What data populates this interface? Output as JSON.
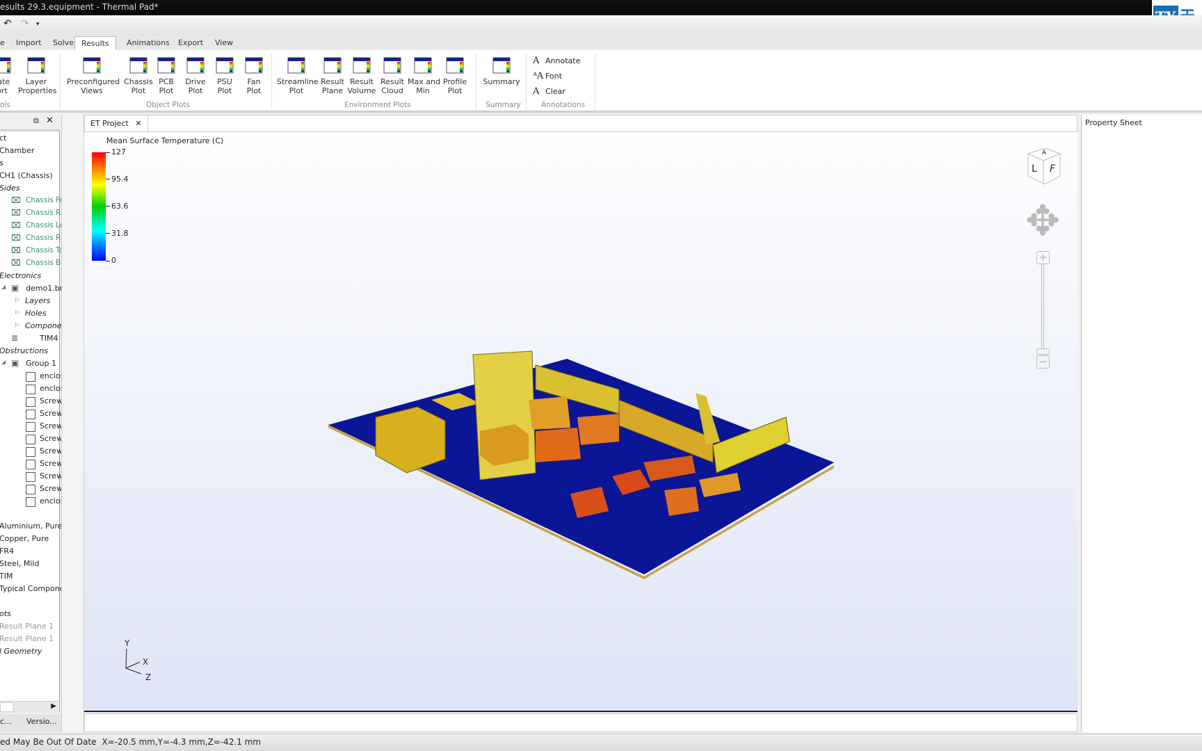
{
  "window": {
    "title": "esults 29.3.equipment - Thermal Pad*"
  },
  "logo": {
    "text": "TY 天 tian",
    "bg": "#1a6fb0"
  },
  "menu_tabs": [
    {
      "label": "e"
    },
    {
      "label": "Import"
    },
    {
      "label": "Solve"
    },
    {
      "label": "Results",
      "active": true
    },
    {
      "label": "Animations"
    },
    {
      "label": "Export"
    },
    {
      "label": "View"
    }
  ],
  "ribbon": {
    "tools": [
      {
        "label": "rate\nort",
        "icon": "report-icon"
      },
      {
        "label": "Layer\nProperties",
        "icon": "layer-properties-icon"
      }
    ],
    "tools_group": "ols",
    "object_plots": [
      {
        "label": "Preconfigured\nViews",
        "icon": "preconfigured-views-icon"
      },
      {
        "label": "Chassis\nPlot",
        "icon": "chassis-plot-icon"
      },
      {
        "label": "PCB\nPlot",
        "icon": "pcb-plot-icon"
      },
      {
        "label": "Drive\nPlot",
        "icon": "drive-plot-icon"
      },
      {
        "label": "PSU\nPlot",
        "icon": "psu-plot-icon"
      },
      {
        "label": "Fan\nPlot",
        "icon": "fan-plot-icon"
      }
    ],
    "object_plots_group": "Object Plots",
    "environment_plots": [
      {
        "label": "Streamline\nPlot",
        "icon": "streamline-icon"
      },
      {
        "label": "Result\nPlane",
        "icon": "result-plane-icon"
      },
      {
        "label": "Result\nVolume",
        "icon": "result-volume-icon"
      },
      {
        "label": "Result\nCloud",
        "icon": "result-cloud-icon"
      },
      {
        "label": "Max and\nMin",
        "icon": "max-min-icon"
      },
      {
        "label": "Profile\nPlot",
        "icon": "profile-plot-icon"
      }
    ],
    "environment_plots_group": "Environment Plots",
    "summary": {
      "label": "Summary",
      "group": "Summary"
    },
    "annotations": {
      "items": [
        {
          "label": "Annotate",
          "icon": "annotate-icon"
        },
        {
          "label": "Font",
          "icon": "font-icon"
        },
        {
          "label": "Clear",
          "icon": "clear-icon"
        }
      ],
      "group": "Annotations"
    }
  },
  "tree": [
    {
      "label": "ct",
      "indent": 0
    },
    {
      "label": "Chamber",
      "indent": 0
    },
    {
      "label": "s",
      "indent": 0,
      "italic": true
    },
    {
      "label": "CH1 (Chassis)",
      "indent": 0
    },
    {
      "label": "Sides",
      "indent": 0,
      "italic": true
    },
    {
      "label": "Chassis Fr",
      "indent": 2,
      "teal": true,
      "icon": "chassis-side-icon"
    },
    {
      "label": "Chassis R",
      "indent": 2,
      "teal": true,
      "icon": "chassis-side-icon"
    },
    {
      "label": "Chassis Le",
      "indent": 2,
      "teal": true,
      "icon": "chassis-side-icon"
    },
    {
      "label": "Chassis R",
      "indent": 2,
      "teal": true,
      "icon": "chassis-side-icon"
    },
    {
      "label": "Chassis To",
      "indent": 2,
      "teal": true,
      "icon": "chassis-side-icon"
    },
    {
      "label": "Chassis Bo",
      "indent": 2,
      "teal": true,
      "icon": "chassis-side-icon"
    },
    {
      "label": "Electronics",
      "indent": 0,
      "italic": true
    },
    {
      "label": "demo1.br",
      "indent": 1,
      "icon": "pcb-icon",
      "expand": "◢"
    },
    {
      "label": "Layers",
      "indent": 2,
      "italic": true,
      "expand": "▷"
    },
    {
      "label": "Holes",
      "indent": 2,
      "italic": true,
      "expand": "▷"
    },
    {
      "label": "Componen",
      "indent": 2,
      "italic": true,
      "expand": "▷"
    },
    {
      "label": "TIM4",
      "indent": 2,
      "icon": "tim-icon"
    },
    {
      "label": "Obstructions",
      "indent": 0,
      "italic": true
    },
    {
      "label": "Group 1",
      "indent": 1,
      "icon": "group-icon",
      "expand": "◢"
    },
    {
      "label": "enclos",
      "indent": 2,
      "check": true
    },
    {
      "label": "enclos",
      "indent": 2,
      "check": true
    },
    {
      "label": "Screw",
      "indent": 2,
      "check": true
    },
    {
      "label": "Screw",
      "indent": 2,
      "check": true
    },
    {
      "label": "Screw",
      "indent": 2,
      "check": true
    },
    {
      "label": "Screw",
      "indent": 2,
      "check": true
    },
    {
      "label": "Screw",
      "indent": 2,
      "check": true
    },
    {
      "label": "Screw",
      "indent": 2,
      "check": true
    },
    {
      "label": "Screw",
      "indent": 2,
      "check": true
    },
    {
      "label": "Screw",
      "indent": 2,
      "check": true
    },
    {
      "label": "enclos",
      "indent": 2,
      "check": true
    },
    {
      "label": "",
      "indent": 0
    },
    {
      "label": "Aluminium, Pure",
      "indent": 0
    },
    {
      "label": "Copper, Pure",
      "indent": 0
    },
    {
      "label": "FR4",
      "indent": 0
    },
    {
      "label": "Steel, Mild",
      "indent": 0
    },
    {
      "label": "TIM",
      "indent": 0
    },
    {
      "label": "Typical Componen",
      "indent": 0
    },
    {
      "label": "",
      "indent": 0
    },
    {
      "label": "ots",
      "indent": 0,
      "italic": true
    },
    {
      "label": "Result Plane 1",
      "indent": 0,
      "grey": true
    },
    {
      "label": "Result Plane 1",
      "indent": 0,
      "grey": true
    },
    {
      "label": "l Geometry",
      "indent": 0,
      "italic": true
    }
  ],
  "left_bottom_tabs": [
    {
      "label": "c..."
    },
    {
      "label": "Versio..."
    }
  ],
  "viewport": {
    "tab": "ET Project",
    "legend": {
      "title": "Mean Surface Temperature (C)",
      "ticks": [
        "127",
        "95.4",
        "63.6",
        "31.8",
        "0"
      ],
      "min": 0,
      "max": 127,
      "colors": [
        "#ff0000",
        "#ffff00",
        "#00d000",
        "#00ffff",
        "#0000ff"
      ]
    },
    "view_cube": {
      "faces": [
        "L",
        "F",
        "A"
      ]
    },
    "axes": {
      "labels": [
        "Y",
        "X",
        "Z"
      ]
    }
  },
  "property_sheet": {
    "title": "Property Sheet"
  },
  "status": {
    "text": "ed May Be Out Of Date",
    "coords": "X=-20.5 mm,Y=-4.3 mm,Z=-42.1 mm"
  }
}
